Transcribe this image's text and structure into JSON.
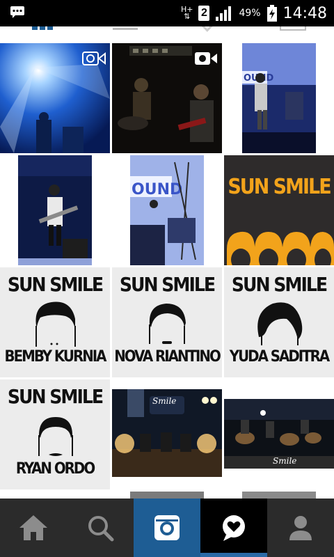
{
  "status_bar": {
    "signal_type": "H+",
    "sim_slot": "2",
    "battery": "49%",
    "time": "14:48",
    "icons": [
      "notification-chat-icon",
      "data-arrows-icon",
      "signal-bars-icon",
      "battery-icon"
    ]
  },
  "grid": {
    "posters": [
      {
        "brand": "SUN SMILE",
        "name": "BEMBY KURNIA"
      },
      {
        "brand": "SUN SMILE",
        "name": "NOVA RIANTINO"
      },
      {
        "brand": "SUN SMILE",
        "name": "YUDA SADITRA"
      },
      {
        "brand": "SUN SMILE",
        "name": "RYAN ORDO"
      }
    ],
    "banner": {
      "brand": "SUN SMILE"
    },
    "stage_banner_text": "OUND",
    "small_logo_text": "Smile"
  },
  "nav": {
    "items": [
      "home-icon",
      "search-icon",
      "camera-icon",
      "activity-heart-icon",
      "profile-icon"
    ],
    "active": "activity-heart-icon"
  },
  "colors": {
    "status_bg": "#000000",
    "nav_bg": "#2b2b2b",
    "nav_camera_bg": "#1e5d94",
    "nav_active_bg": "#000000",
    "accent_orange": "#f2a31b"
  }
}
